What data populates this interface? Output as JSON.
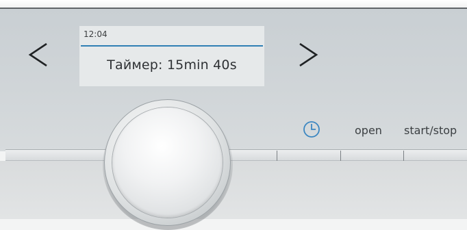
{
  "display": {
    "clock": "12:04",
    "timer_text": "Таймер: 15min 40s",
    "accent_color": "#2f7fb4"
  },
  "navigation": {
    "prev_icon": "chevron-left-icon",
    "next_icon": "chevron-right-icon"
  },
  "controls": {
    "timer_icon": "clock-icon",
    "open_label": "open",
    "start_stop_label": "start/stop"
  },
  "knob": {
    "icon": "rotary-dial"
  }
}
